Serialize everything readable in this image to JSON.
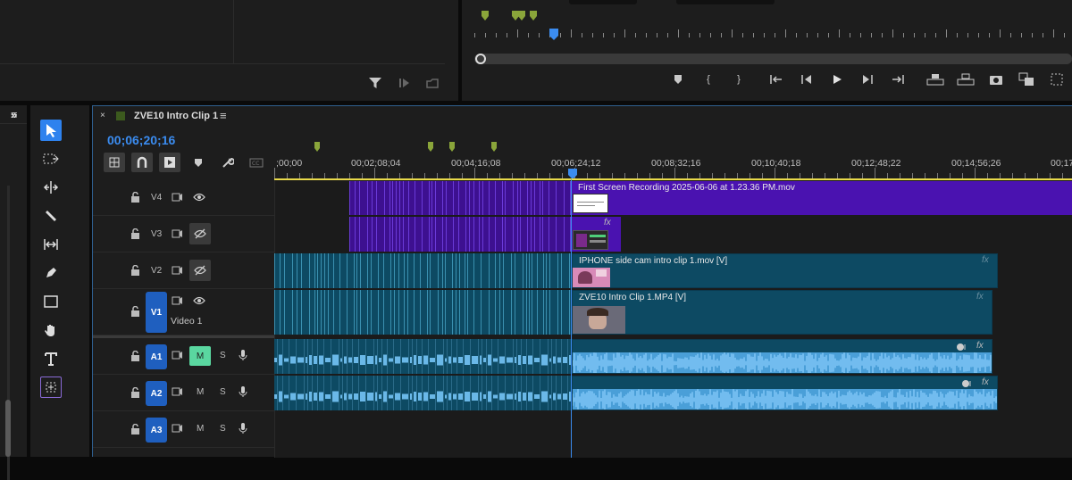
{
  "project_panel": {
    "icons": [
      "filter-icon",
      "automate-icon",
      "new-bin-icon"
    ]
  },
  "program_monitor": {
    "controls": [
      "add-marker",
      "mark-in",
      "mark-out",
      "go-to-in",
      "step-back",
      "play",
      "step-forward",
      "go-to-out",
      "lift",
      "extract",
      "export-frame",
      "compare",
      "insert-overwrite"
    ]
  },
  "timeline": {
    "sequence_name": "ZVE10 Intro Clip 1",
    "timecode": "00;06;20;16",
    "ruler_labels": [
      ";00;00",
      "00;02;08;04",
      "00;04;16;08",
      "00;06;24;12",
      "00;08;32;16",
      "00;10;40;18",
      "00;12;48;22",
      "00;14;56;26",
      "00;17"
    ],
    "video_tracks": [
      {
        "name": "V4",
        "eye": "visible"
      },
      {
        "name": "V3",
        "eye": "hidden"
      },
      {
        "name": "V2",
        "eye": "hidden"
      },
      {
        "name": "V1",
        "label": "Video 1",
        "eye": "visible"
      }
    ],
    "audio_tracks": [
      {
        "name": "A1",
        "m": "M",
        "s": "S",
        "m_active": true
      },
      {
        "name": "A2",
        "m": "M",
        "s": "S",
        "m_active": false
      },
      {
        "name": "A3",
        "m": "M",
        "s": "S",
        "m_active": false
      }
    ],
    "clips": {
      "v4": "First Screen Recording 2025-06-06 at 1.23.36 PM.mov",
      "v2": "IPHONE side cam intro clip 1.mov [V]",
      "v1": "ZVE10 Intro Clip 1.MP4 [V]",
      "fx": "fx"
    },
    "colors": {
      "purple": "#4a12b0",
      "teal": "#0d4a63",
      "audio": "#4a9fd8",
      "accent": "#2f7fd8"
    }
  }
}
